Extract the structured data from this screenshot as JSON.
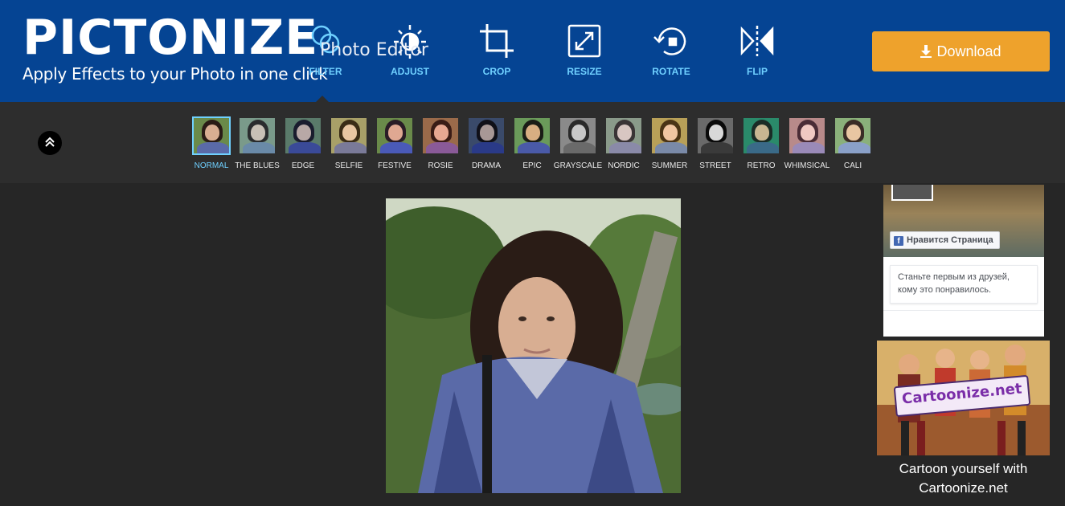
{
  "app": {
    "logo_text": "PICTONIZE",
    "tagline": "Apply Effects to your Photo in one click",
    "overlay_title": "Photo Editor"
  },
  "toolbar": {
    "tools": [
      {
        "label": "FILTER",
        "icon": "filter-icon",
        "active": true
      },
      {
        "label": "ADJUST",
        "icon": "adjust-icon",
        "active": false
      },
      {
        "label": "CROP",
        "icon": "crop-icon",
        "active": false
      },
      {
        "label": "RESIZE",
        "icon": "resize-icon",
        "active": false
      },
      {
        "label": "ROTATE",
        "icon": "rotate-icon",
        "active": false
      },
      {
        "label": "FLIP",
        "icon": "flip-icon",
        "active": false
      }
    ],
    "download_label": "Download",
    "accent": "#6fd0ff",
    "header_color": "#054493",
    "download_color": "#eea22c"
  },
  "filters": {
    "items": [
      {
        "label": "NORMAL",
        "active": true
      },
      {
        "label": "THE BLUES"
      },
      {
        "label": "EDGE"
      },
      {
        "label": "SELFIE"
      },
      {
        "label": "FESTIVE"
      },
      {
        "label": "ROSIE"
      },
      {
        "label": "DRAMA"
      },
      {
        "label": "EPIC"
      },
      {
        "label": "GRAYSCALE"
      },
      {
        "label": "NORDIC"
      },
      {
        "label": "SUMMER"
      },
      {
        "label": "STREET"
      },
      {
        "label": "RETRO"
      },
      {
        "label": "WHIMSICAL"
      },
      {
        "label": "CALI"
      }
    ]
  },
  "facebook": {
    "like_label": "Нравится Страница",
    "friends_text": "Станьте первым из друзей, кому это понравилось."
  },
  "ad": {
    "sign_text": "Cartoonize.net",
    "caption_line1": "Cartoon yourself with",
    "caption_line2": "Cartoonize.net"
  }
}
